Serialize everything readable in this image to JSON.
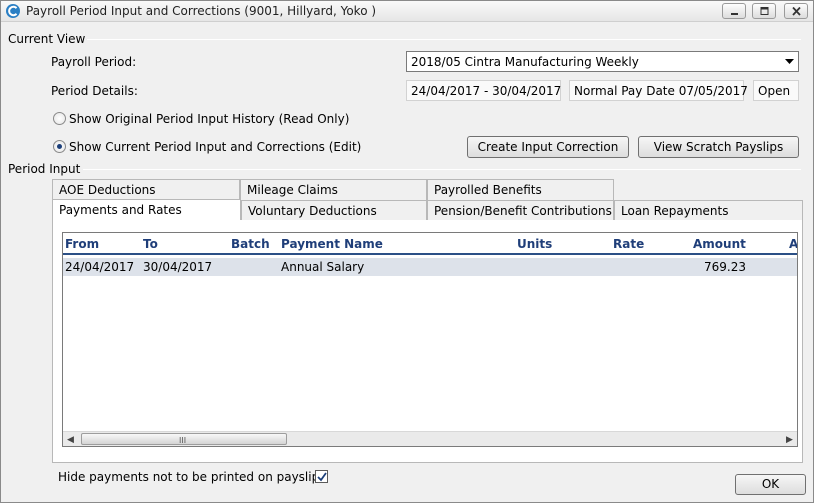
{
  "window": {
    "title": "Payroll Period Input and Corrections (9001, Hillyard, Yoko )"
  },
  "current_view": {
    "section_label": "Current View",
    "payroll_period_label": "Payroll Period:",
    "payroll_period_value": "2018/05 Cintra Manufacturing Weekly",
    "period_details_label": "Period Details:",
    "period_dates": "24/04/2017 - 30/04/2017",
    "pay_date": "Normal Pay Date 07/05/2017",
    "status": "Open",
    "radio_history_label": "Show Original Period Input History (Read Only)",
    "radio_current_label": "Show Current Period Input and Corrections (Edit)",
    "selected_radio": "current",
    "create_correction_button": "Create Input Correction",
    "view_scratch_button": "View Scratch Payslips"
  },
  "period_input": {
    "section_label": "Period Input",
    "tabs_row1": [
      "AOE Deductions",
      "Mileage Claims",
      "Payrolled Benefits"
    ],
    "tabs_row2": [
      "Payments and Rates",
      "Voluntary Deductions",
      "Pension/Benefit Contributions",
      "Loan Repayments"
    ],
    "active_tab": "Payments and Rates"
  },
  "grid": {
    "columns": [
      "From",
      "To",
      "Batch",
      "Payment Name",
      "Units",
      "Rate",
      "Amount",
      "A"
    ],
    "rows": [
      {
        "from": "24/04/2017",
        "to": "30/04/2017",
        "batch": "",
        "payment_name": "Annual Salary",
        "units": "",
        "rate": "",
        "amount": "769.23"
      }
    ],
    "scroll_grip": "III"
  },
  "footer": {
    "hide_payments_label": "Hide payments not to be printed on payslips",
    "hide_payments_checked": true,
    "ok_button": "OK"
  },
  "colors": {
    "header_text": "#1f3e79",
    "header_underline": "#2b4f86",
    "selected_row": "#dde2ea"
  }
}
